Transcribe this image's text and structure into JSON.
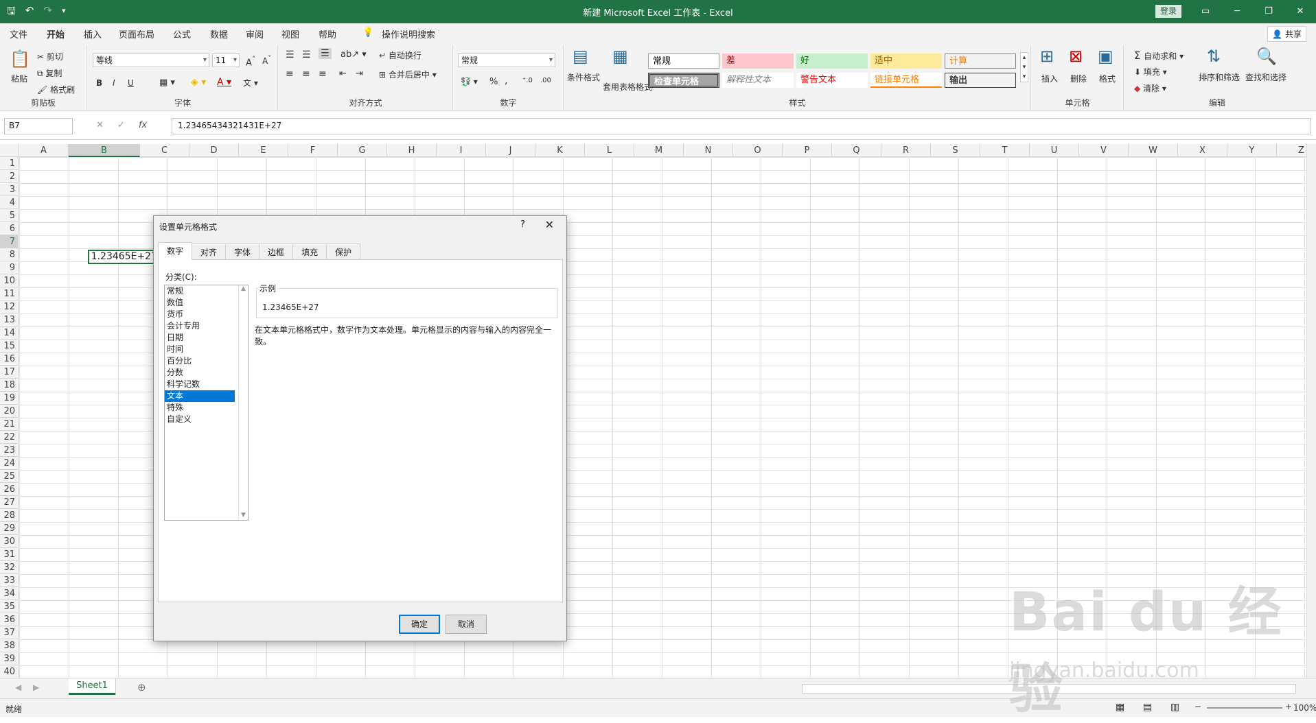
{
  "app": {
    "title": "新建 Microsoft Excel 工作表  -  Excel",
    "login": "登录",
    "qat": [
      "save-icon",
      "undo-icon",
      "redo-icon",
      "customize-icon"
    ]
  },
  "menu": {
    "tabs": [
      "文件",
      "开始",
      "插入",
      "页面布局",
      "公式",
      "数据",
      "审阅",
      "视图",
      "帮助"
    ],
    "active": "开始",
    "search": "操作说明搜索",
    "share": "共享"
  },
  "ribbon": {
    "clipboard": {
      "paste": "粘贴",
      "cut": "剪切",
      "copy": "复制",
      "painter": "格式刷",
      "label": "剪贴板"
    },
    "font": {
      "name": "等线",
      "size": "11",
      "label": "字体",
      "bold": "B",
      "italic": "I",
      "underline": "U"
    },
    "align": {
      "wrap": "自动换行",
      "merge": "合并后居中",
      "label": "对齐方式"
    },
    "number": {
      "format": "常规",
      "label": "数字"
    },
    "styles": {
      "cond": "条件格式",
      "table": "套用表格格式",
      "label": "样式",
      "cells": [
        {
          "text": "常规",
          "bg": "#ffffff",
          "fg": "#000000"
        },
        {
          "text": "差",
          "bg": "#ffc7ce",
          "fg": "#9c0006"
        },
        {
          "text": "好",
          "bg": "#c6efce",
          "fg": "#006100"
        },
        {
          "text": "适中",
          "bg": "#ffeb9c",
          "fg": "#9c5700"
        },
        {
          "text": "计算",
          "bg": "#f2f2f2",
          "fg": "#fa7d00"
        },
        {
          "text": "检查单元格",
          "bg": "#a5a5a5",
          "fg": "#ffffff"
        },
        {
          "text": "解释性文本",
          "bg": "#ffffff",
          "fg": "#7f7f7f"
        },
        {
          "text": "警告文本",
          "bg": "#ffffff",
          "fg": "#ff0000"
        },
        {
          "text": "链接单元格",
          "bg": "#ffffff",
          "fg": "#fa7d00"
        },
        {
          "text": "输出",
          "bg": "#f2f2f2",
          "fg": "#3f3f3f"
        }
      ]
    },
    "cells": {
      "insert": "插入",
      "delete": "删除",
      "format": "格式",
      "label": "单元格"
    },
    "edit": {
      "autosum": "自动求和",
      "fill": "填充",
      "clear": "清除",
      "sort": "排序和筛选",
      "find": "查找和选择",
      "label": "编辑"
    }
  },
  "formula": {
    "namebox": "B7",
    "value": "1.23465434321431E+27",
    "fx": "fx"
  },
  "grid": {
    "columns": [
      "A",
      "B",
      "C",
      "D",
      "E",
      "F",
      "G",
      "H",
      "I",
      "J",
      "K",
      "L",
      "M",
      "N",
      "O",
      "P",
      "Q",
      "R",
      "S",
      "T",
      "U",
      "V",
      "W",
      "X",
      "Y",
      "Z"
    ],
    "rows": [
      "1",
      "2",
      "3",
      "4",
      "5",
      "6",
      "7",
      "8",
      "9",
      "10",
      "11",
      "12",
      "13",
      "14",
      "15",
      "16",
      "17",
      "18",
      "19",
      "20",
      "21",
      "22",
      "23",
      "24",
      "25",
      "26",
      "27",
      "28",
      "29",
      "30",
      "31",
      "32",
      "33",
      "34",
      "35",
      "36",
      "37",
      "38",
      "39",
      "40"
    ],
    "active_cell_display": "1.23465E+27",
    "selected_column": "B",
    "selected_row": "7"
  },
  "sheet": {
    "tab": "Sheet1"
  },
  "status": {
    "text": "就绪",
    "zoom": "100%"
  },
  "dialog": {
    "title": "设置单元格格式",
    "help": "?",
    "close": "✕",
    "tabs": [
      "数字",
      "对齐",
      "字体",
      "边框",
      "填充",
      "保护"
    ],
    "active_tab": "数字",
    "category_label": "分类(C):",
    "categories": [
      "常规",
      "数值",
      "货币",
      "会计专用",
      "日期",
      "时间",
      "百分比",
      "分数",
      "科学记数",
      "文本",
      "特殊",
      "自定义"
    ],
    "selected_category": "文本",
    "sample_label": "示例",
    "sample_value": "1.23465E+27",
    "description": "在文本单元格格式中，数字作为文本处理。单元格显示的内容与输入的内容完全一致。",
    "ok": "确定",
    "cancel": "取消"
  },
  "watermark": {
    "text": "Bai du 经验",
    "url": "jingyan.baidu.com"
  }
}
